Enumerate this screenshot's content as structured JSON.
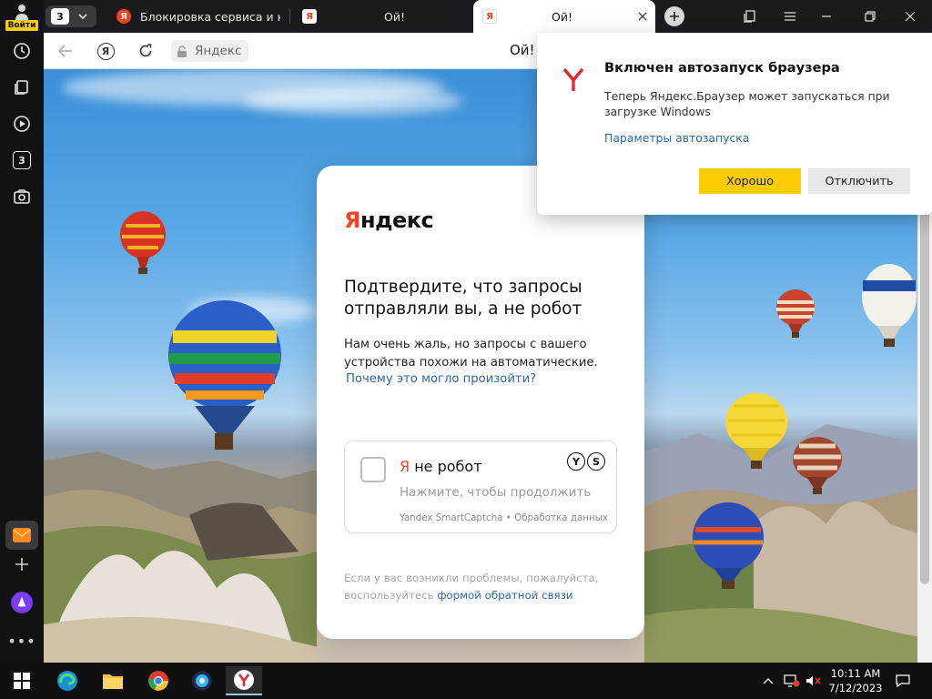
{
  "sidebar": {
    "login_label": "Войти",
    "tab_count": "3"
  },
  "tabs": [
    {
      "label": "Блокировка сервиса и ка",
      "active": false
    },
    {
      "label": "Ой!",
      "active": false
    },
    {
      "label": "Ой!",
      "active": true
    }
  ],
  "tabgroup_count": "3",
  "addressbar": {
    "site_label": "Яндекс",
    "page_title": "Ой!"
  },
  "captcha": {
    "logo_ya": "Я",
    "logo_rest": "ндекс",
    "title": "Подтвердите, что запросы отправляли вы, а не робот",
    "text": "Нам очень жаль, но запросы с вашего устройства похожи на автоматические.",
    "why_link": "Почему это могло произойти?",
    "notrobot_ya": "Я",
    "notrobot_rest": " не робот",
    "hint": "Нажмите, чтобы продолжить",
    "brand": "Yandex SmartCaptcha • Обработка данных",
    "feedback_text": "Если у вас возникли проблемы, пожалуйста, воспользуйтесь ",
    "feedback_link": "формой обратной связи"
  },
  "popup": {
    "title": "Включен автозапуск браузера",
    "text": "Теперь Яндекс.Браузер может запускаться при загрузке Windows",
    "link": "Параметры автозапуска",
    "ok": "Хорошо",
    "off": "Отключить"
  },
  "taskbar": {
    "time": "10:11 AM",
    "date": "7/12/2023"
  },
  "colors": {
    "yandex_red": "#fc3f1d",
    "accent_yellow": "#ffcc00",
    "link_blue": "#2a67b1"
  }
}
